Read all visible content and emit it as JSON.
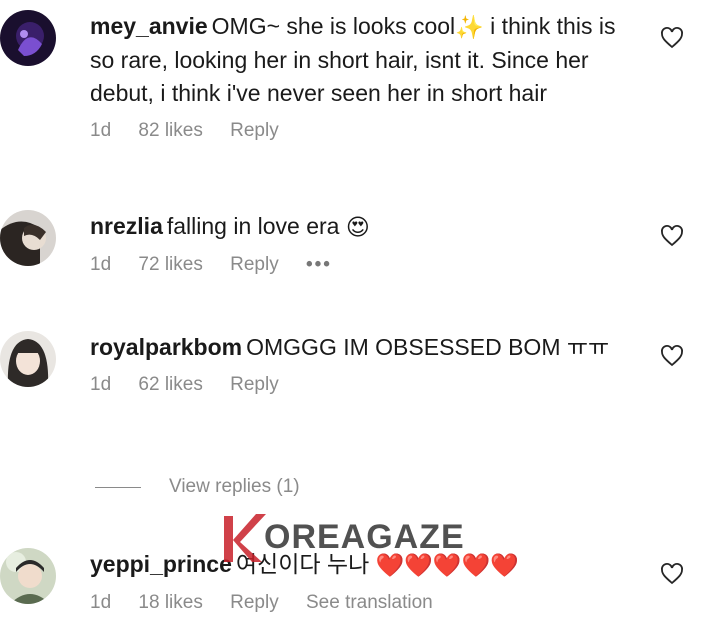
{
  "comments": [
    {
      "username": "mey_anvie",
      "text": "OMG~ she is looks cool",
      "emoji": "✨",
      "text_after": " i think this is so rare, looking her in short hair, isnt it. Since her debut, i think i've never seen her in short hair",
      "time": "1d",
      "likes": "82 likes",
      "reply": "Reply"
    },
    {
      "username": "nrezlia",
      "text": "falling in love era",
      "emoji": "😍",
      "time": "1d",
      "likes": "72 likes",
      "reply": "Reply",
      "more": "•••"
    },
    {
      "username": "royalparkbom",
      "text": "OMGGG IM OBSESSED BOM ㅠㅠ",
      "time": "1d",
      "likes": "62 likes",
      "reply": "Reply"
    },
    {
      "username": "yeppi_prince",
      "text": "여신이다 누나",
      "emoji": "❤️❤️❤️❤️❤️",
      "time": "1d",
      "likes": "18 likes",
      "reply": "Reply",
      "translation": "See translation"
    }
  ],
  "view_replies": "View replies (1)",
  "watermark": "OREAGAZE",
  "colors": {
    "meta": "#8a8a8a",
    "heart_stroke": "#262626",
    "watermark_red": "#c8202a"
  },
  "icons": {
    "like": "heart-outline-icon",
    "more": "more-dots-icon"
  }
}
